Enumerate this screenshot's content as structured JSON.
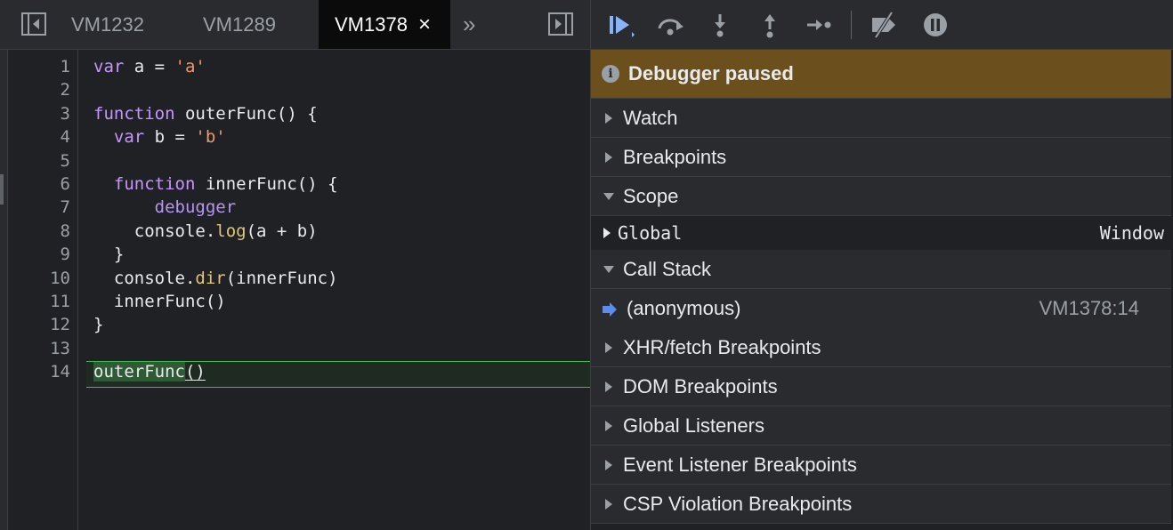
{
  "source_tabs": [
    {
      "label": "VM1232"
    },
    {
      "label": "VM1289"
    },
    {
      "label": "VM1378",
      "close": "×"
    }
  ],
  "overflow_glyph": "»",
  "code": {
    "line_numbers": [
      "1",
      "2",
      "3",
      "4",
      "5",
      "6",
      "7",
      "8",
      "9",
      "10",
      "11",
      "12",
      "13",
      "14"
    ],
    "lines": [
      [
        {
          "t": "var",
          "c": "kw"
        },
        {
          "t": " a = "
        },
        {
          "t": "'a'",
          "c": "str"
        }
      ],
      [],
      [
        {
          "t": "function",
          "c": "kw"
        },
        {
          "t": " outerFunc() {"
        }
      ],
      [
        {
          "t": "  "
        },
        {
          "t": "var",
          "c": "kw"
        },
        {
          "t": " b = "
        },
        {
          "t": "'b'",
          "c": "str"
        }
      ],
      [],
      [
        {
          "t": "  "
        },
        {
          "t": "function",
          "c": "kw"
        },
        {
          "t": " innerFunc() {"
        }
      ],
      [
        {
          "t": "      "
        },
        {
          "t": "debugger",
          "c": "dbg"
        }
      ],
      [
        {
          "t": "    console."
        },
        {
          "t": "log",
          "c": "fn"
        },
        {
          "t": "(a + b)"
        }
      ],
      [
        {
          "t": "  }"
        }
      ],
      [
        {
          "t": "  console."
        },
        {
          "t": "dir",
          "c": "fn"
        },
        {
          "t": "(innerFunc)"
        }
      ],
      [
        {
          "t": "  innerFunc()"
        }
      ],
      [
        {
          "t": "}"
        }
      ],
      [],
      [
        {
          "t": "outerFunc",
          "c": "hl"
        },
        {
          "t": "()",
          "c": "ul"
        }
      ]
    ],
    "paused_line": 14
  },
  "debugger": {
    "banner": "Debugger paused",
    "sections": {
      "watch": "Watch",
      "breakpoints": "Breakpoints",
      "scope": "Scope",
      "call_stack": "Call Stack",
      "xhr": "XHR/fetch Breakpoints",
      "dom": "DOM Breakpoints",
      "global_listeners": "Global Listeners",
      "event_listener": "Event Listener Breakpoints",
      "csp": "CSP Violation Breakpoints"
    },
    "scope": {
      "name": "Global",
      "value": "Window"
    },
    "call_stack": [
      {
        "function": "(anonymous)",
        "location": "VM1378:14"
      }
    ]
  },
  "colors": {
    "paused_banner": "#6b4f1c",
    "accent": "#8ab4f8",
    "paused_line": "#3fb950"
  },
  "icons": [
    "toggle-navigator-icon",
    "more-tabs-icon",
    "toggle-debugger-icon",
    "resume-icon",
    "step-over-icon",
    "step-into-icon",
    "step-out-icon",
    "step-icon",
    "deactivate-breakpoints-icon",
    "pause-on-exceptions-icon",
    "info-icon",
    "current-frame-arrow-icon"
  ]
}
